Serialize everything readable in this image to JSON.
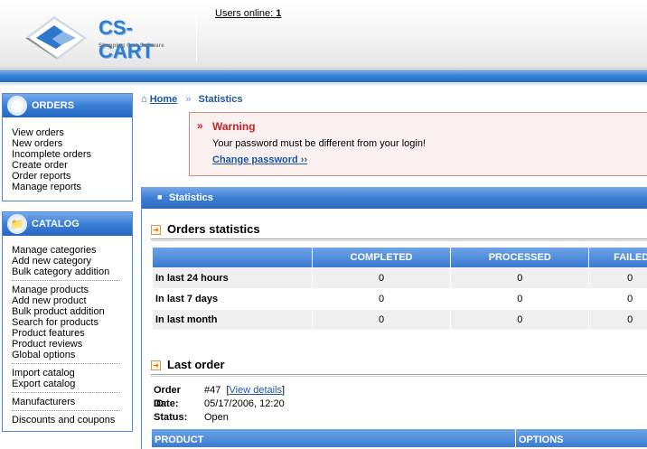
{
  "header": {
    "logo_text": "CS-CART",
    "logo_sub": "Shopping Cart Software",
    "users_online_label": "Users online:",
    "users_online_count": "1"
  },
  "sidebar": {
    "orders": {
      "title": "ORDERS",
      "icon": "orders-icon",
      "items": [
        "View orders",
        "New orders",
        "Incomplete orders",
        "Create order",
        "Order reports",
        "Manage reports"
      ]
    },
    "catalog": {
      "title": "CATALOG",
      "icon": "folder-icon",
      "groups": [
        [
          "Manage categories",
          "Add new category",
          "Bulk category addition"
        ],
        [
          "Manage products",
          "Add new product",
          "Bulk product addition",
          "Search for products",
          "Product features",
          "Product reviews",
          "Global options"
        ],
        [
          "Import catalog",
          "Export catalog"
        ],
        [
          "Manufacturers"
        ],
        [
          "Discounts and coupons"
        ]
      ]
    }
  },
  "breadcrumb": {
    "home": "Home",
    "current": "Statistics"
  },
  "warning": {
    "title": "Warning",
    "text": "Your password must be different from your login!",
    "link": "Change password ››"
  },
  "panel": {
    "title": "Statistics"
  },
  "orders_stats": {
    "title": "Orders statistics",
    "columns": [
      "COMPLETED",
      "PROCESSED",
      "FAILED"
    ],
    "rows": [
      {
        "label": "In last 24 hours",
        "values": [
          "0",
          "0",
          "0"
        ]
      },
      {
        "label": "In last 7 days",
        "values": [
          "0",
          "0",
          "0"
        ]
      },
      {
        "label": "In last month",
        "values": [
          "0",
          "0",
          "0"
        ]
      }
    ]
  },
  "last_order": {
    "title": "Last order",
    "order_id_label": "Order ID",
    "order_id": "#47",
    "details_link": "View details",
    "date_label": "Date",
    "date": "05/17/2006, 12:20",
    "status_label": "Status",
    "status": "Open",
    "columns": [
      "PRODUCT",
      "OPTIONS"
    ]
  },
  "colors": {
    "accent": "#3a7fd7",
    "warning_title": "#c62222",
    "link": "#1d56a5"
  }
}
